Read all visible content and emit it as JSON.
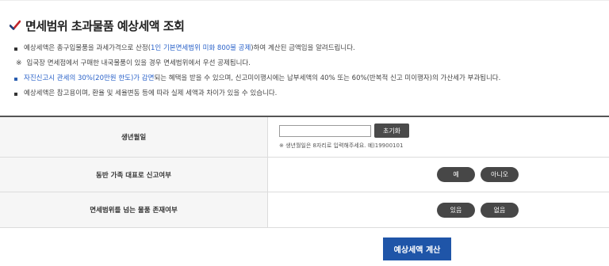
{
  "title": "면세범위 초과물품 예상세액 조회",
  "notes": {
    "n1": {
      "before": "예상세액은 총구입물품을 과세가격으로 산정(",
      "link": "1인 기본면세범위 미화 800불 공제",
      "after": ")하여 계산된 금액임을 알려드립니다."
    },
    "n2": {
      "mark": "※",
      "text": "입국장 면세점에서 구매한 내국물품이 있을 경우 면세범위에서 우선 공제됩니다."
    },
    "n3": {
      "link": "자진신고시 관세의 30%(20만원 한도)가 감면",
      "after": "되는 혜택을 받을 수 있으며, 신고미이행시에는 납부세액의 40% 또는 60%(반복적 신고 미이행자)의 가산세가 부과됩니다."
    },
    "n4": {
      "text": "예상세액은 참고용이며, 환율 및 세율변동 등에 따라 실제 세액과 차이가 있을 수 있습니다."
    }
  },
  "form": {
    "birth": {
      "label": "생년월일",
      "value": "",
      "reset_label": "초기화",
      "hint": "※ 생년월일은 8자리로 입력해주세요. 예)19900101"
    },
    "family": {
      "label": "동반 가족 대표로 신고여부",
      "yes_label": "예",
      "no_label": "아니오"
    },
    "exceed": {
      "label": "면세범위를 넘는 물품 존재여부",
      "yes_label": "있음",
      "no_label": "없음"
    }
  },
  "calc_button": "예상세액 계산",
  "colors": {
    "accent_blue": "#1f55a8",
    "link_blue": "#2a62c9",
    "dark_button": "#474747"
  }
}
